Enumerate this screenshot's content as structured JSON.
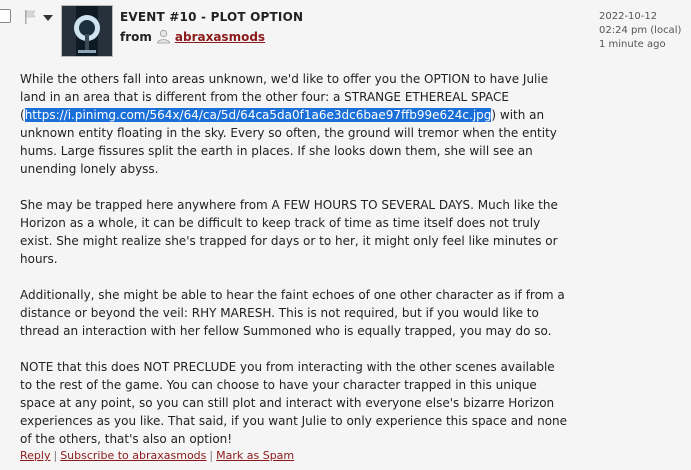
{
  "post": {
    "title": "EVENT #10 - PLOT OPTION",
    "from_label": "from",
    "username": "abraxasmods",
    "date": "2022-10-12",
    "time": "02:24 pm (local)",
    "ago": "1 minute ago"
  },
  "content": {
    "p1_before": "While the others fall into areas unknown, we'd like to offer you the OPTION to have Julie land in an area that is different from the other four: a STRANGE ETHEREAL SPACE (",
    "p1_link": "https://i.pinimg.com/564x/64/ca/5d/64ca5da0f1a6e3dc6bae97ffb99e624c.jpg",
    "p1_after": ") with an unknown entity floating in the sky. Every so often, the ground will tremor when the entity hums. Large fissures split the earth in places. If she looks down them, she will see an unending lonely abyss.",
    "p2": "She may be trapped here anywhere from A FEW HOURS TO SEVERAL DAYS. Much like the Horizon as a whole, it can be difficult to keep track of time as time itself does not truly exist. She might realize she's trapped for days or to her, it might only feel like minutes or hours.",
    "p3": "Additionally, she might be able to hear the faint echoes of one other character as if from a distance or beyond the veil: RHY MARESH. This is not required, but if you would like to thread an interaction with her fellow Summoned who is equally trapped, you may do so.",
    "p4": "NOTE that this does NOT PRECLUDE you from interacting with the other scenes available to the rest of the game. You can choose to have your character trapped in this unique space at any point, so you can still plot and interact with everyone else's bizarre Horizon experiences as you like. That said, if you want Julie to only experience this space and none of the others, that's also an option!"
  },
  "actions": {
    "reply": "Reply",
    "subscribe": "Subscribe to abraxasmods",
    "spam": "Mark as Spam",
    "separator": "|"
  },
  "icons": {
    "flag": "flag-icon",
    "dropdown": "chevron-down-icon",
    "user": "user-icon"
  },
  "colors": {
    "link": "#8b1a1a",
    "selection": "#1a6fd8",
    "background": "#f5f5f5"
  }
}
